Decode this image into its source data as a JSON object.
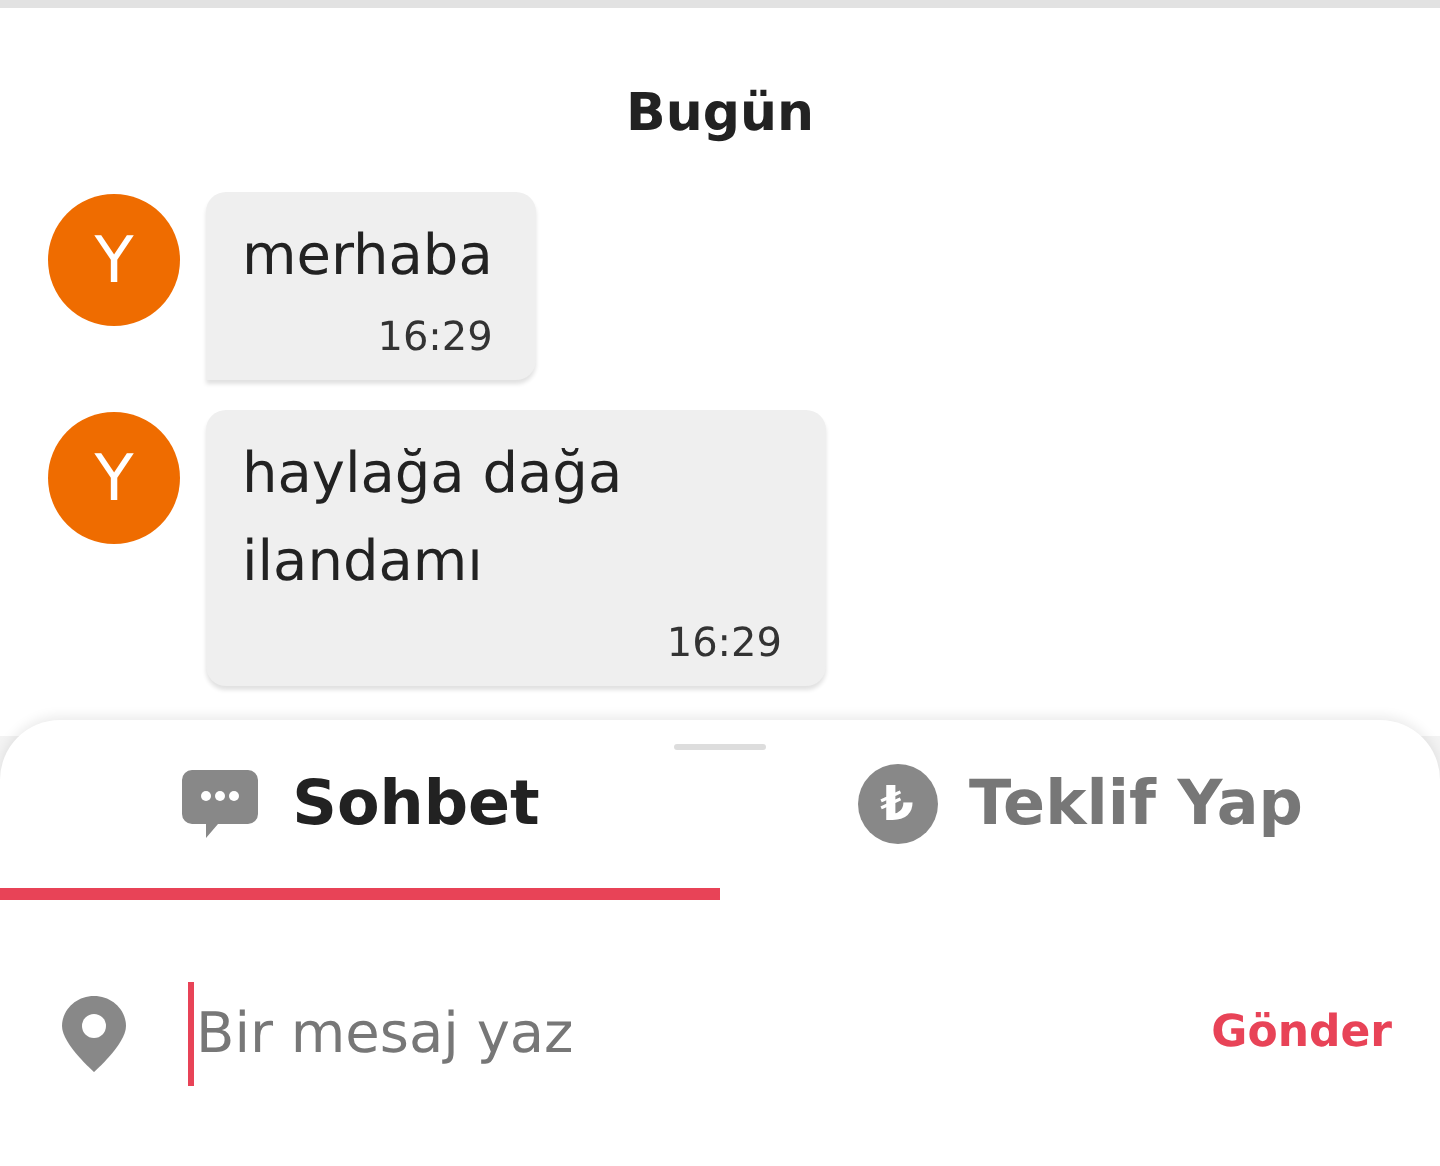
{
  "date_label": "Bugün",
  "messages": [
    {
      "avatar": "Y",
      "text": "merhaba",
      "time": "16:29"
    },
    {
      "avatar": "Y",
      "text": "haylağa dağa ilandamı",
      "time": "16:29"
    }
  ],
  "tabs": [
    {
      "label": "Sohbet",
      "selected": true,
      "kind": "chat"
    },
    {
      "label": "Teklif Yap",
      "selected": false,
      "kind": "currency",
      "symbol": "₺"
    }
  ],
  "composer": {
    "placeholder": "Bir mesaj yaz",
    "focused": true,
    "send": "Gönder"
  }
}
